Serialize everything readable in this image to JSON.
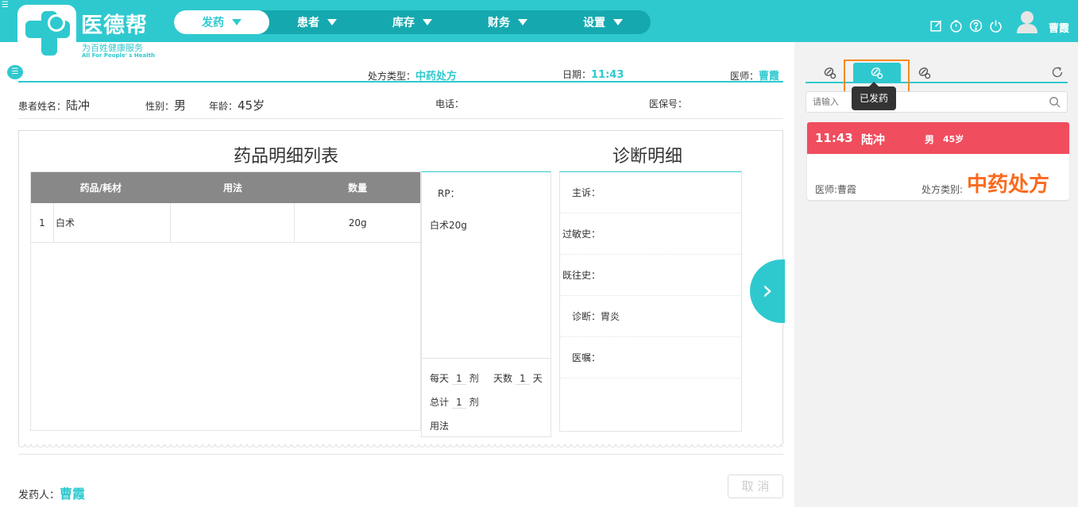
{
  "header": {
    "brand_name": "医德帮",
    "brand_tagline": "为百姓健康服务",
    "brand_tagline_en": "All For People' s Health",
    "nav": [
      {
        "label": "发药",
        "active": true
      },
      {
        "label": "患者",
        "active": false
      },
      {
        "label": "库存",
        "active": false
      },
      {
        "label": "财务",
        "active": false
      },
      {
        "label": "设置",
        "active": false
      }
    ],
    "icons": [
      "edit-icon",
      "timer-icon",
      "help-icon",
      "power-icon"
    ],
    "user_name": "曹霞"
  },
  "prescription": {
    "type_label": "处方类型：",
    "type_value": "中药处方",
    "date_label": "日期：",
    "date_value": "11:43",
    "doctor_label": "医师：",
    "doctor_value": "曹霞"
  },
  "patient": {
    "name_label": "患者姓名：",
    "name_value": "陆冲",
    "gender_label": "性别：",
    "gender_value": "男",
    "age_label": "年龄：",
    "age_value": "45岁",
    "phone_label": "电话：",
    "insurance_label": "医保号："
  },
  "med_list": {
    "title": "药品明细列表",
    "columns": [
      "药品/耗材",
      "用法",
      "数量"
    ],
    "rows": [
      {
        "index": "1",
        "name": "白术",
        "usage": "",
        "quantity": "20g"
      }
    ]
  },
  "rp": {
    "label": "RP：",
    "content": "白术20g",
    "per_day_label": "每天",
    "per_day_value": "1",
    "dose_unit": "剂",
    "days_label": "天数",
    "days_value": "1",
    "days_unit": "天",
    "total_label": "总计",
    "total_value": "1",
    "total_unit": "剂",
    "usage_label": "用法"
  },
  "diagnosis": {
    "title": "诊断明细",
    "rows": [
      "主诉：",
      "过敏史：",
      "既往史：",
      "诊断：胃炎",
      "医嘱："
    ]
  },
  "footer": {
    "dispenser_label": "发药人：",
    "dispenser_value": "曹霞",
    "cancel_label": "取 消"
  },
  "right_panel": {
    "tooltip": "已发药",
    "search_placeholder": "请输入",
    "card": {
      "time": "11:43",
      "name": "陆冲",
      "gender": "男",
      "age": "45岁",
      "doctor": "医师:曹霞",
      "type_label": "处方类别:",
      "type_value": "中药处方"
    }
  },
  "colors": {
    "accent": "#2ec9cf",
    "card_header": "#f04d5e",
    "highlight": "#f7891f",
    "type_value": "#fa6a1e"
  }
}
